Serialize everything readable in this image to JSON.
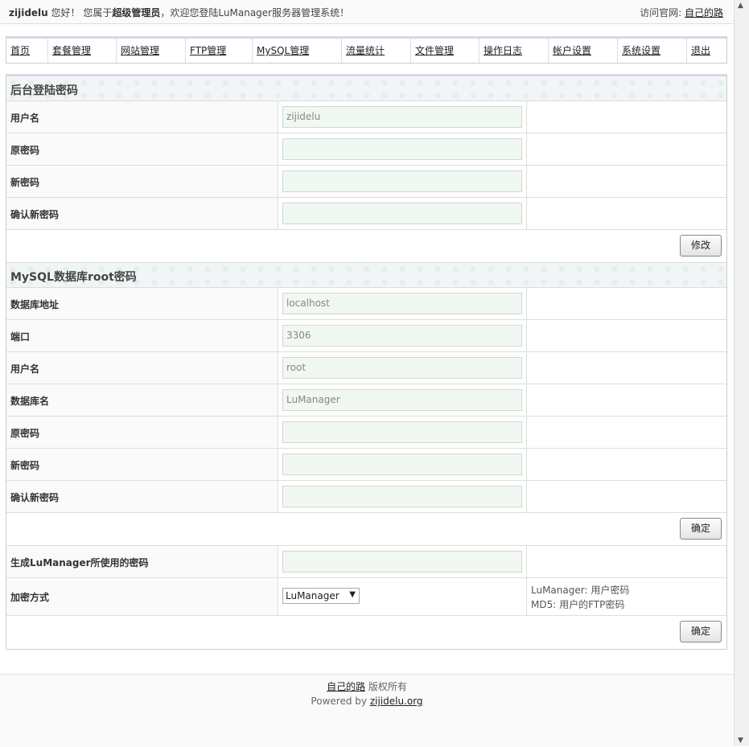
{
  "topbar": {
    "username": "zijidelu",
    "hello": "您好！",
    "belong_prefix": "您属于",
    "role": "超级管理员",
    "welcome": "，欢迎您登陆LuManager服务器管理系统！",
    "visit_label": "访问官网:",
    "visit_link": "自己的路"
  },
  "nav": [
    "首页",
    "套餐管理",
    "网站管理",
    "FTP管理",
    "MySQL管理",
    "流量统计",
    "文件管理",
    "操作日志",
    "帐户设置",
    "系统设置",
    "退出"
  ],
  "login_section": {
    "title": "后台登陆密码",
    "rows": [
      {
        "label": "用户名",
        "value": "zijidelu"
      },
      {
        "label": "原密码",
        "value": ""
      },
      {
        "label": "新密码",
        "value": ""
      },
      {
        "label": "确认新密码",
        "value": ""
      }
    ],
    "button": "修改"
  },
  "mysql_section": {
    "title": "MySQL数据库root密码",
    "rows": [
      {
        "label": "数据库地址",
        "value": "localhost"
      },
      {
        "label": "端口",
        "value": "3306"
      },
      {
        "label": "用户名",
        "value": "root"
      },
      {
        "label": "数据库名",
        "value": "LuManager"
      },
      {
        "label": "原密码",
        "value": ""
      },
      {
        "label": "新密码",
        "value": ""
      },
      {
        "label": "确认新密码",
        "value": ""
      }
    ],
    "button": "确定"
  },
  "gen_section": {
    "gen_label": "生成LuManager所使用的密码",
    "gen_value": "",
    "enc_label": "加密方式",
    "enc_selected": "LuManager",
    "enc_note_1": "LuManager: 用户密码",
    "enc_note_2": "MD5: 用户的FTP密码",
    "button": "确定"
  },
  "footer": {
    "owner_link": "自己的路",
    "rights": "版权所有",
    "powered": "Powered by",
    "powered_link": "zijidelu.org"
  }
}
